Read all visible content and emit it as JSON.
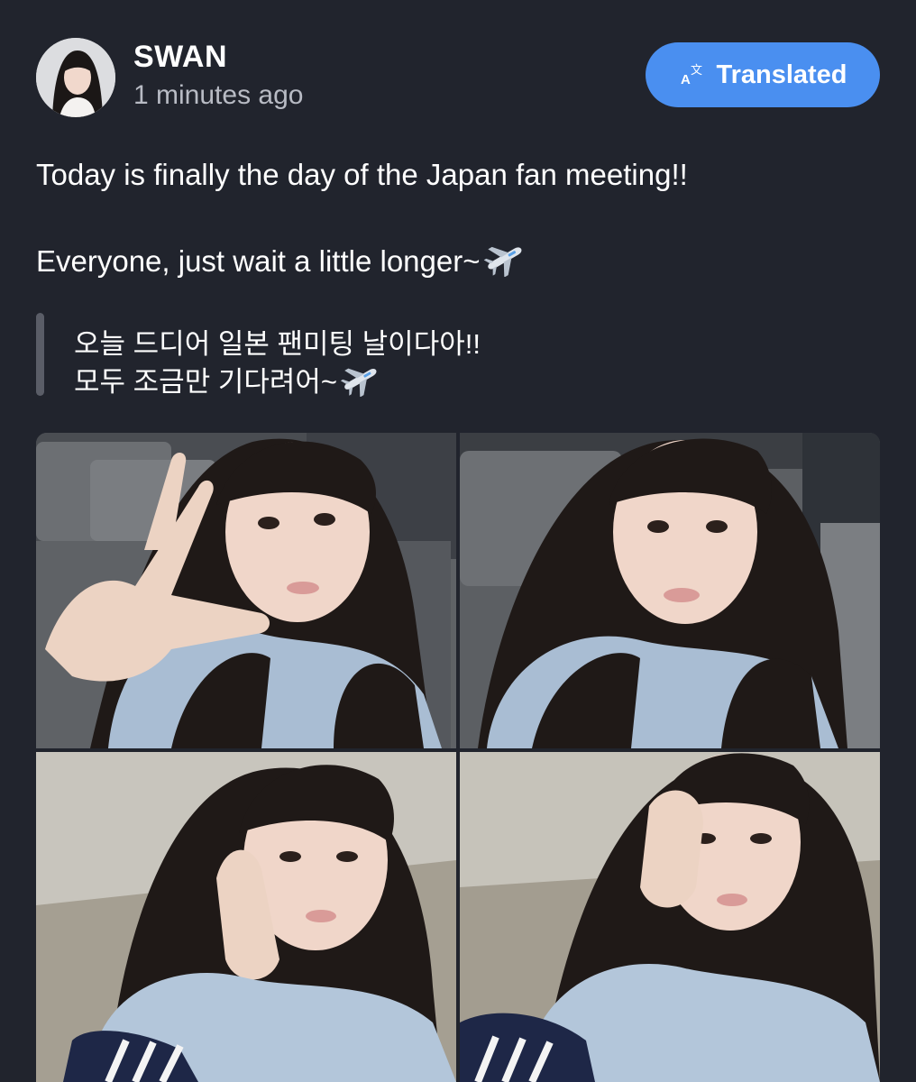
{
  "post": {
    "author": {
      "name": "SWAN",
      "timestamp": "1 minutes ago"
    },
    "translate_button": {
      "label": "Translated",
      "icon": "translate-icon",
      "color": "#4a8ff0"
    },
    "translated_text": {
      "line1": "Today is finally the day of the Japan fan meeting!!",
      "line2": "Everyone, just wait a little longer~",
      "line2_emoji": "airplane-icon"
    },
    "original_text": {
      "line1": "오늘 드디어 일본 팬미팅 날이다아!!",
      "line2": "모두 조금만 기다려어~",
      "line2_emoji": "airplane-icon"
    },
    "photos": [
      {
        "name": "selfie-peace-sign"
      },
      {
        "name": "selfie-pout"
      },
      {
        "name": "selfie-hand-on-cheek"
      },
      {
        "name": "selfie-fist-on-cheek"
      }
    ]
  },
  "colors": {
    "background": "#21242d",
    "text_primary": "#ffffff",
    "text_secondary": "#b8bbc4",
    "quote_bar": "#5a5d67"
  }
}
